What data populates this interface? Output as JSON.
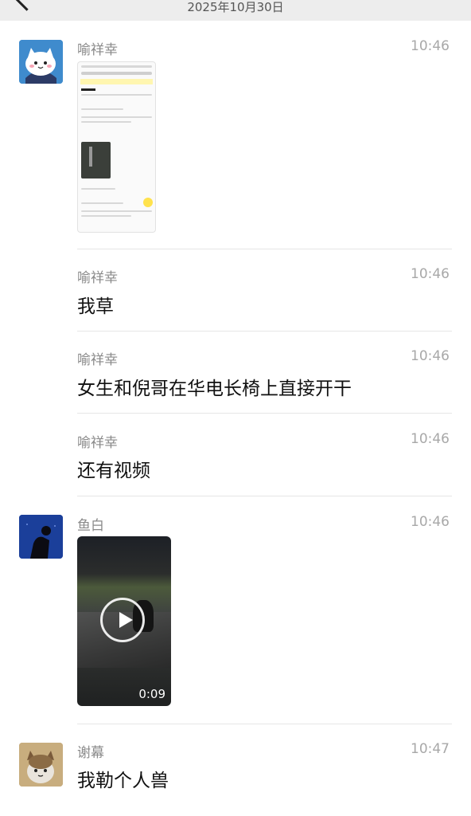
{
  "header": {
    "date": "2025年10月30日"
  },
  "messages": [
    {
      "sender": "喻祥幸",
      "time": "10:46",
      "type": "image",
      "text": ""
    },
    {
      "sender": "喻祥幸",
      "time": "10:46",
      "type": "text",
      "text": "我草"
    },
    {
      "sender": "喻祥幸",
      "time": "10:46",
      "type": "text",
      "text": "女生和倪哥在华电长椅上直接开干"
    },
    {
      "sender": "喻祥幸",
      "time": "10:46",
      "type": "text",
      "text": "还有视频"
    },
    {
      "sender": "鱼白",
      "time": "10:46",
      "type": "video",
      "duration": "0:09"
    },
    {
      "sender": "谢幕",
      "time": "10:47",
      "type": "text",
      "text": "我勒个人兽"
    }
  ],
  "icons": {
    "back": "chevron-left-icon",
    "play": "play-icon"
  },
  "colors": {
    "topbar": "#ededed",
    "name": "#8a8a8a",
    "time": "#a8a8a8"
  }
}
